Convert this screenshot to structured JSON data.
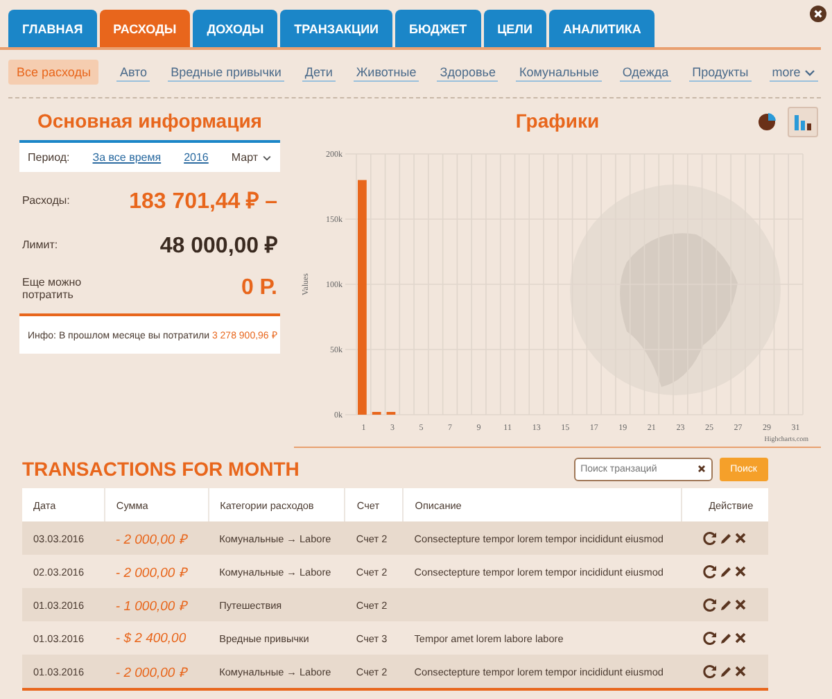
{
  "tabs": [
    {
      "label": "ГЛАВНАЯ",
      "selected": false
    },
    {
      "label": "РАСХОДЫ",
      "selected": true
    },
    {
      "label": "ДОХОДЫ",
      "selected": false
    },
    {
      "label": "ТРАНЗАКЦИИ",
      "selected": false
    },
    {
      "label": "БЮДЖЕТ",
      "selected": false
    },
    {
      "label": "ЦЕЛИ",
      "selected": false
    },
    {
      "label": "АНАЛИТИКА",
      "selected": false
    }
  ],
  "subtabs": [
    {
      "label": "Все расходы",
      "selected": true
    },
    {
      "label": "Авто",
      "selected": false
    },
    {
      "label": "Вредные привычки",
      "selected": false
    },
    {
      "label": "Дети",
      "selected": false
    },
    {
      "label": "Животные",
      "selected": false
    },
    {
      "label": "Здоровье",
      "selected": false
    },
    {
      "label": "Комунальные",
      "selected": false
    },
    {
      "label": "Одежда",
      "selected": false
    },
    {
      "label": "Продукты",
      "selected": false
    }
  ],
  "more": {
    "label": "more"
  },
  "info": {
    "title": "Основная информация",
    "period": {
      "label": "Период:",
      "links": [
        "За все время",
        "2016"
      ],
      "month": "Март"
    },
    "rows": [
      {
        "label": "Расходы:",
        "value": "183 701,44 ₽ –",
        "kind": "accent"
      },
      {
        "label": "Лимит:",
        "value": "48 000,00 ₽",
        "kind": "plain"
      },
      {
        "label": "Еще можно потратить",
        "value": "0 Р.",
        "kind": "accent"
      }
    ],
    "note": {
      "text": "Инфо: В прошлом месяце вы потратили",
      "amount": "3 278 900,96 ₽"
    }
  },
  "charts": {
    "title": "Графики",
    "chart_types": [
      {
        "kind": "pie",
        "selected": false
      },
      {
        "kind": "bar",
        "selected": true
      }
    ],
    "credit": "Highcharts.com",
    "chart_data": {
      "type": "bar",
      "ylabel": "Values",
      "x": [
        1,
        2,
        3
      ],
      "grid": true,
      "xlim": [
        0.5,
        31.5
      ],
      "series": [
        {
          "color": "#e8661c",
          "values": [
            180000,
            2000,
            2000
          ]
        }
      ],
      "ylim": [
        0,
        200000
      ],
      "yticks": [
        {
          "value": 0,
          "label": "0k"
        },
        {
          "value": 50000,
          "label": "50k"
        },
        {
          "value": 100000,
          "label": "100k"
        },
        {
          "value": 150000,
          "label": "150k"
        },
        {
          "value": 200000,
          "label": "200k"
        }
      ],
      "xticks": [
        1,
        3,
        5,
        7,
        9,
        11,
        13,
        15,
        17,
        19,
        21,
        23,
        25,
        27,
        29,
        31
      ]
    }
  },
  "transactions": {
    "title": "TRANSACTIONS FOR MONTH",
    "search": {
      "placeholder": "Поиск транзаций"
    },
    "search_button": "Поиск",
    "columns": [
      "Дата",
      "Сумма",
      "Категории расходов",
      "Счет",
      "Описание",
      "Действие"
    ],
    "rows": [
      {
        "date": "03.03.2016",
        "amount": "- 2 000,00 ₽",
        "category": "Комунальные → Labore",
        "account": "Счет 2",
        "description": "Consectepture tempor lorem tempor incididunt eiusmod"
      },
      {
        "date": "02.03.2016",
        "amount": "- 2 000,00 ₽",
        "category": "Комунальные → Labore",
        "account": "Счет 2",
        "description": "Consectepture tempor lorem tempor incididunt eiusmod"
      },
      {
        "date": "01.03.2016",
        "amount": "- 1 000,00 ₽",
        "category": "Путешествия",
        "account": "Счет 2"
      },
      {
        "date": "01.03.2016",
        "amount": "- $ 2 400,00",
        "category": "Вредные привычки",
        "account": "Счет 3",
        "description": "Tempor amet lorem labore labore"
      },
      {
        "date": "01.03.2016",
        "amount": "- 2 000,00 ₽",
        "category": "Комунальные → Labore",
        "account": "Счет 2",
        "description": "Consectepture tempor lorem tempor incididunt eiusmod"
      }
    ]
  }
}
